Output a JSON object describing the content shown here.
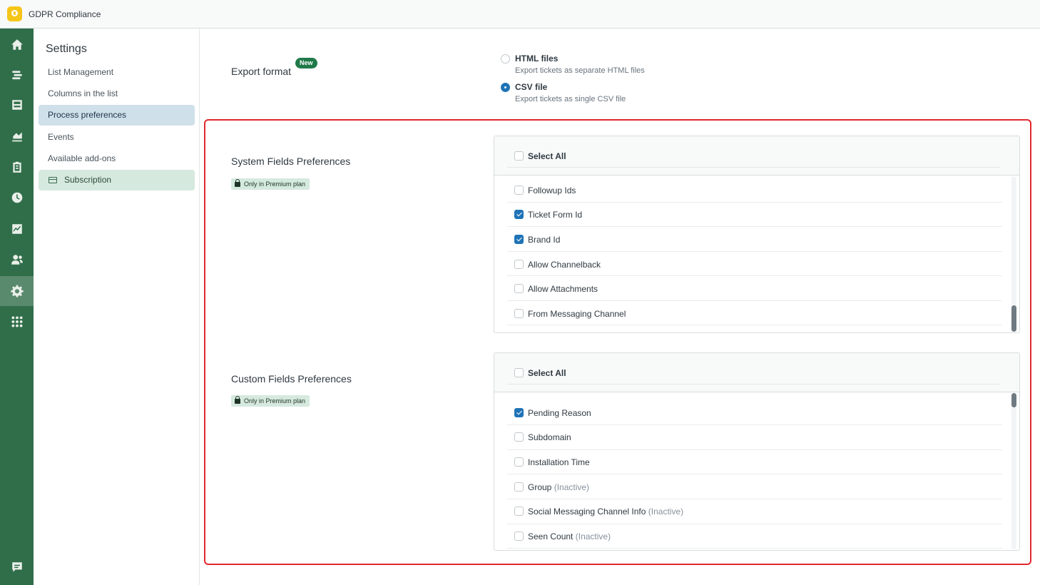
{
  "app": {
    "title": "GDPR Compliance"
  },
  "rail": {
    "icons": [
      "home-icon",
      "views-icon",
      "inbox-icon",
      "reporting-icon",
      "clipboard-icon",
      "clock-icon",
      "chart-icon",
      "users-icon",
      "settings-icon",
      "apps-grid-icon",
      "chat-icon"
    ],
    "active": "settings-icon"
  },
  "sidebar": {
    "title": "Settings",
    "items": [
      {
        "label": "List Management"
      },
      {
        "label": "Columns in the list"
      },
      {
        "label": "Process preferences",
        "active": true
      },
      {
        "label": "Events"
      },
      {
        "label": "Available add-ons"
      },
      {
        "label": "Subscription",
        "icon": "credit-card-icon"
      }
    ]
  },
  "export": {
    "label": "Export format",
    "badge": "New",
    "options": [
      {
        "label": "HTML files",
        "hint": "Export tickets as separate HTML files",
        "checked": false
      },
      {
        "label": "CSV file",
        "hint": "Export tickets as single CSV file",
        "checked": true
      }
    ]
  },
  "system_fields": {
    "title": "System Fields Preferences",
    "badge": "Only in Premium plan",
    "select_all": "Select All",
    "items": [
      {
        "label": "Followup Ids",
        "checked": false
      },
      {
        "label": "Ticket Form Id",
        "checked": true
      },
      {
        "label": "Brand Id",
        "checked": true
      },
      {
        "label": "Allow Channelback",
        "checked": false
      },
      {
        "label": "Allow Attachments",
        "checked": false
      },
      {
        "label": "From Messaging Channel",
        "checked": false
      }
    ]
  },
  "custom_fields": {
    "title": "Custom Fields Preferences",
    "badge": "Only in Premium plan",
    "select_all": "Select All",
    "items": [
      {
        "label": "Pending Reason",
        "checked": true,
        "status": ""
      },
      {
        "label": "Subdomain",
        "checked": false,
        "status": ""
      },
      {
        "label": "Installation Time",
        "checked": false,
        "status": ""
      },
      {
        "label": "Group",
        "checked": false,
        "status": "(Inactive)"
      },
      {
        "label": "Social Messaging Channel Info",
        "checked": false,
        "status": "(Inactive)"
      },
      {
        "label": "Seen Count",
        "checked": false,
        "status": "(Inactive)"
      }
    ]
  },
  "colors": {
    "rail_bg": "#306e4a",
    "accent_blue": "#1f73b7",
    "highlight_red": "#e0282e",
    "badge_green": "#1f7a4a"
  }
}
